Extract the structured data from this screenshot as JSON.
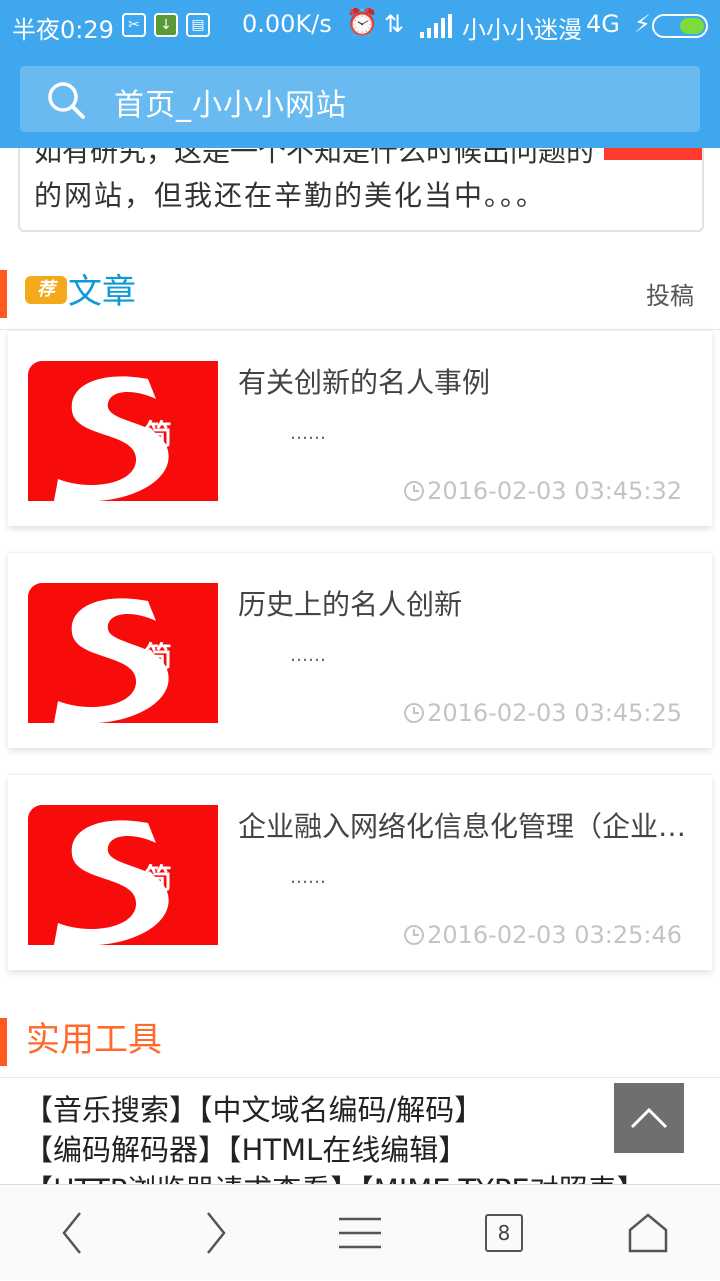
{
  "status_bar": {
    "time": "半夜0:29",
    "speed": "0.00K/s",
    "carrier": "小小小迷漫",
    "network": "4G",
    "icons": [
      "app-icon",
      "download-icon",
      "app-icon",
      "alarm-icon",
      "data-transfer-icon",
      "signal-icon",
      "charging-icon",
      "battery-icon"
    ]
  },
  "search": {
    "text": "首页_小小小网站"
  },
  "intro": {
    "partial_line": "如有研究，这是一个不知是什么时候出问题的",
    "text": "的网站，但我还在辛勤的美化当中。。。"
  },
  "articles_section": {
    "badge": "荐",
    "title": "文章",
    "link": "投稿",
    "title_color": "#0d9ad6"
  },
  "articles": [
    {
      "title": "有关创新的名人事例",
      "excerpt": "……",
      "time": "2016-02-03 03:45:32",
      "thumb_char": "简"
    },
    {
      "title": "历史上的名人创新",
      "excerpt": "……",
      "time": "2016-02-03 03:45:25",
      "thumb_char": "简"
    },
    {
      "title": "企业融入网络化信息化管理（企业管理）",
      "excerpt": "……",
      "time": "2016-02-03 03:25:46",
      "thumb_char": "简"
    }
  ],
  "tools_section": {
    "title": "实用工具",
    "title_color": "#ff6a2b",
    "lines": [
      "【音乐搜索】【中文域名编码/解码】",
      "【编码解码器】【HTML在线编辑】",
      "【HTTP浏览器请求查看】【MIME-TYPE对照表】"
    ]
  },
  "bottom_nav": {
    "tab_count": "8"
  },
  "colors": {
    "header_blue": "#3ea7ee",
    "accent_orange": "#ff5a22",
    "thumb_red": "#f80b0b"
  }
}
